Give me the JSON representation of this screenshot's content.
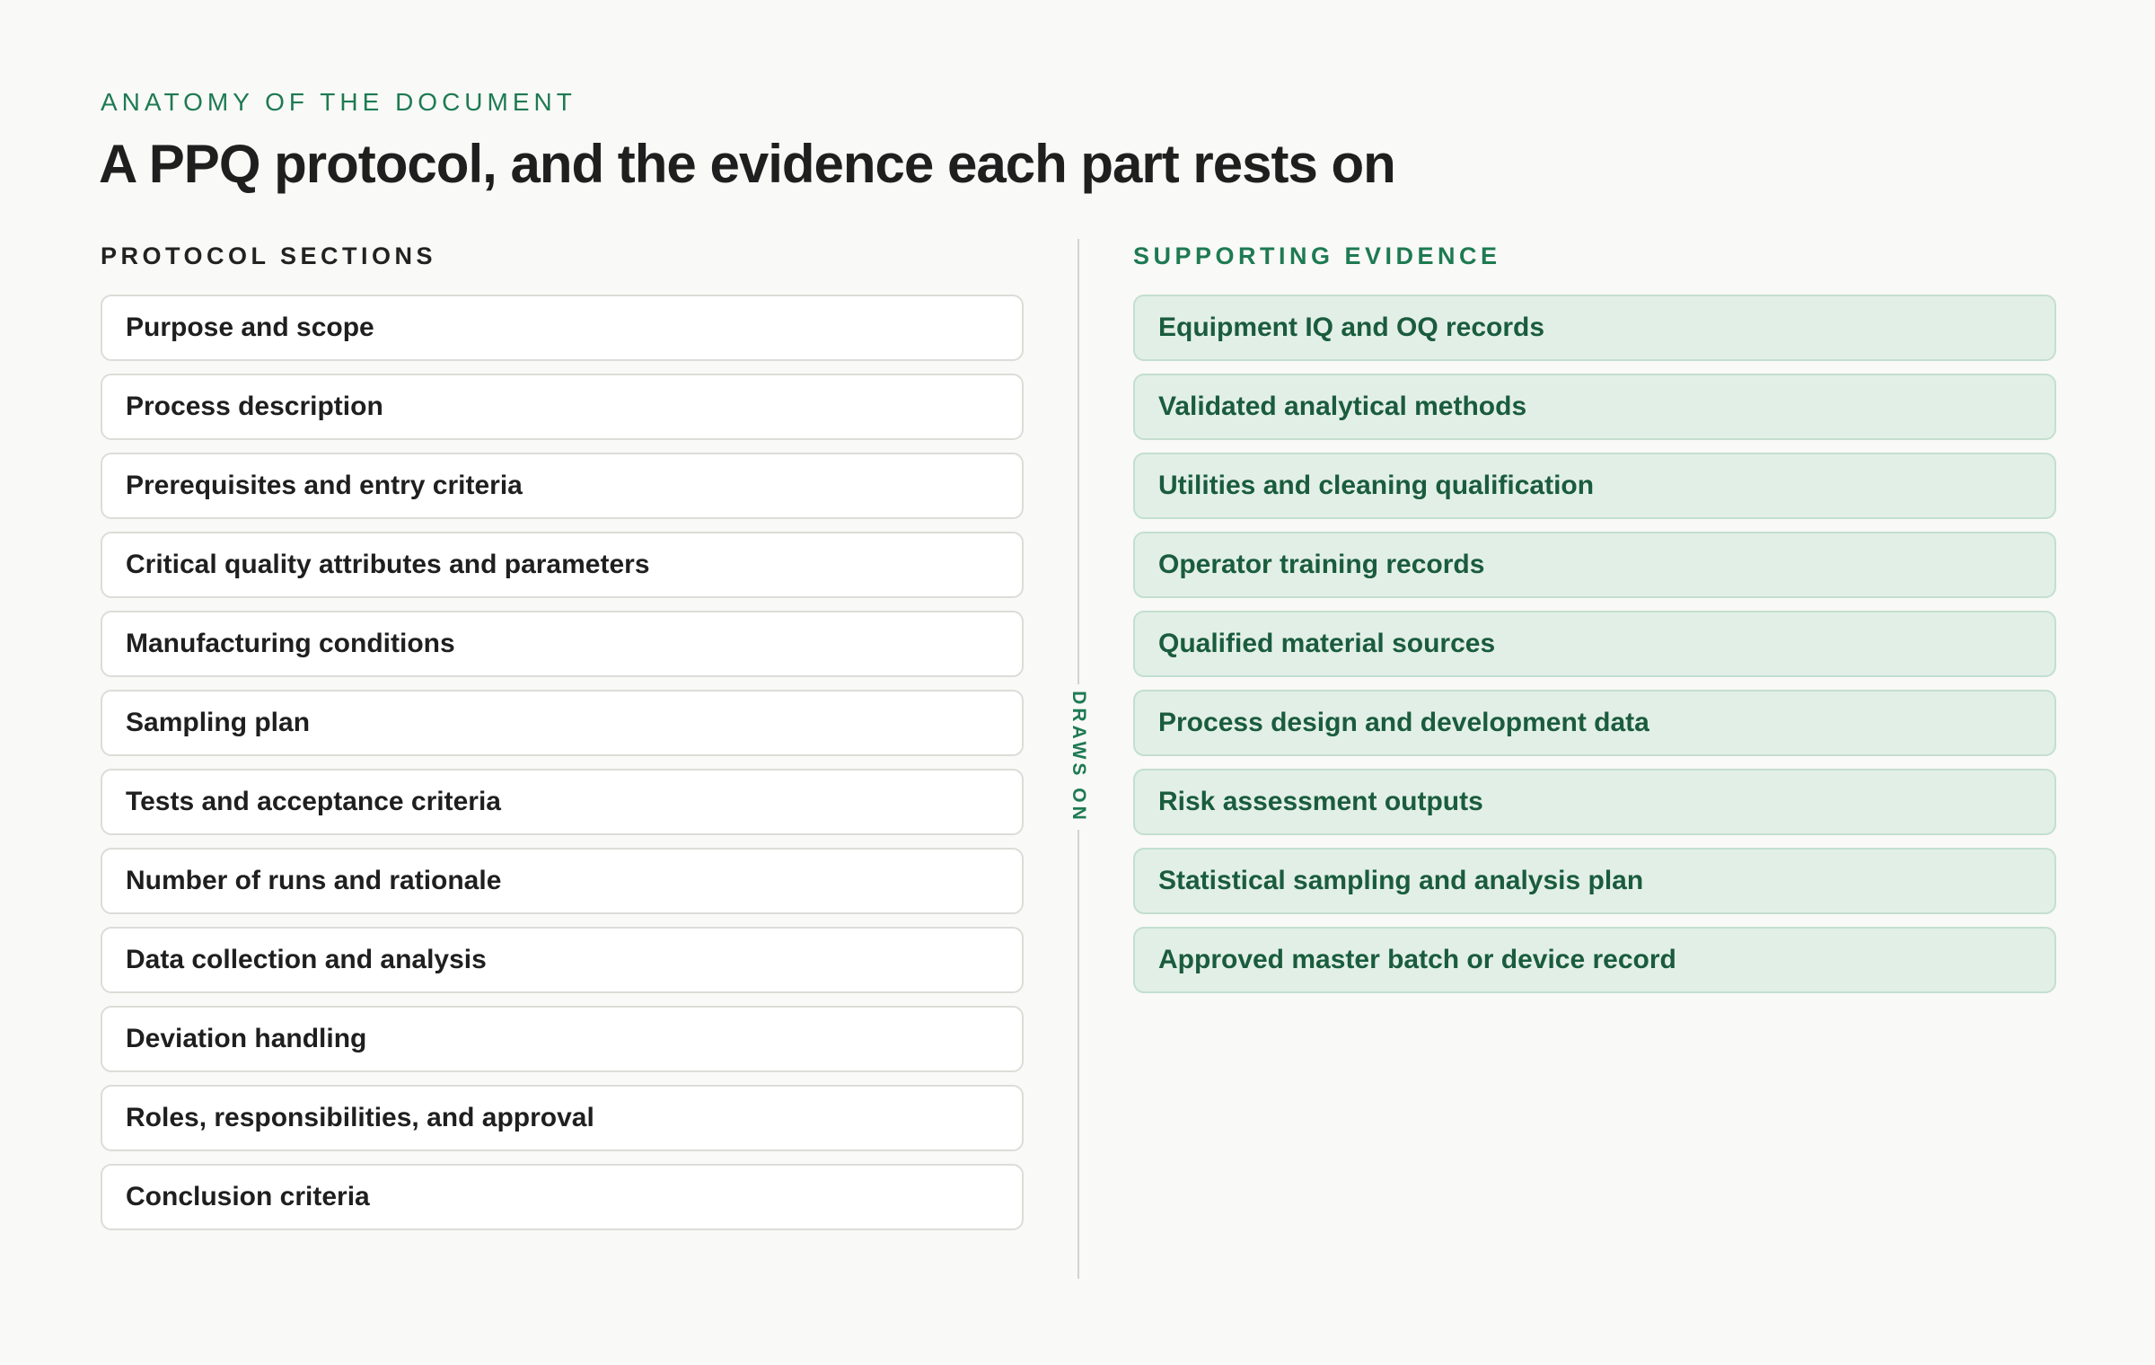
{
  "eyebrow": "ANATOMY OF THE DOCUMENT",
  "title": "A PPQ protocol, and the evidence each part rests on",
  "left_column": {
    "heading": "PROTOCOL SECTIONS",
    "items": [
      "Purpose and scope",
      "Process description",
      "Prerequisites and entry criteria",
      "Critical quality attributes and parameters",
      "Manufacturing conditions",
      "Sampling plan",
      "Tests and acceptance criteria",
      "Number of runs and rationale",
      "Data collection and analysis",
      "Deviation handling",
      "Roles, responsibilities, and approval",
      "Conclusion criteria"
    ]
  },
  "connector": {
    "label": "DRAWS ON"
  },
  "right_column": {
    "heading": "SUPPORTING EVIDENCE",
    "items": [
      "Equipment IQ and OQ records",
      "Validated analytical methods",
      "Utilities and cleaning qualification",
      "Operator training records",
      "Qualified material sources",
      "Process design and development data",
      "Risk assessment outputs",
      "Statistical sampling and analysis plan",
      "Approved master batch or device record"
    ]
  },
  "colors": {
    "accent": "#1e7a52",
    "evidence_fill": "#e2efe7",
    "evidence_text": "#1a5c3d",
    "section_fill": "#ffffff",
    "background": "#f9f9f7"
  }
}
